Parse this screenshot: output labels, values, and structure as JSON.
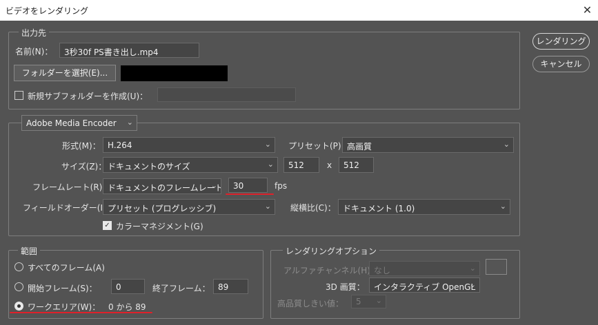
{
  "window": {
    "title": "ビデオをレンダリング",
    "close_glyph": "✕"
  },
  "actions": {
    "render": "レンダリング",
    "cancel": "キャンセル"
  },
  "output": {
    "legend": "出力先",
    "name_label": "名前(N)：",
    "name_value": "3秒30f PS書き出し.mp4",
    "choose_folder": "フォルダーを選択(E)...",
    "new_subfolder_label": "新規サブフォルダーを作成(U)："
  },
  "encoder": {
    "engine": "Adobe Media Encoder",
    "format_label": "形式(M)：",
    "format_value": "H.264",
    "preset_label": "プリセット(P)：",
    "preset_value": "高画質",
    "size_label": "サイズ(Z)：",
    "size_value": "ドキュメントのサイズ",
    "width": "512",
    "x_sep": "x",
    "height": "512",
    "framerate_label": "フレームレート(R)：",
    "framerate_value": "ドキュメントのフレームレート",
    "fps_value": "30",
    "fps_unit": "fps",
    "field_order_label": "フィールドオーダー(I)：",
    "field_order_value": "プリセット (プログレッシブ)",
    "aspect_label": "縦横比(C)：",
    "aspect_value": "ドキュメント (1.0)",
    "color_mgmt_label": "カラーマネジメント(G)",
    "color_mgmt_checked": true
  },
  "range": {
    "legend": "範囲",
    "all_frames": "すべてのフレーム(A)",
    "start_frame_label": "開始フレーム(S)：",
    "start_value": "0",
    "end_frame_label": "終了フレーム：",
    "end_value": "89",
    "work_area_label": "ワークエリア(W)：",
    "work_area_value": "0 から 89",
    "selected": "work_area"
  },
  "render_options": {
    "legend": "レンダリングオプション",
    "alpha_label": "アルファチャンネル(H)：",
    "alpha_value": "なし",
    "quality3d_label": "3D 画質：",
    "quality3d_value": "インタラクティブ OpenGL",
    "hq_threshold_label": "高品質しきい値：",
    "hq_threshold_value": "5"
  },
  "annotations": {
    "underline_color": "#e0202a"
  }
}
